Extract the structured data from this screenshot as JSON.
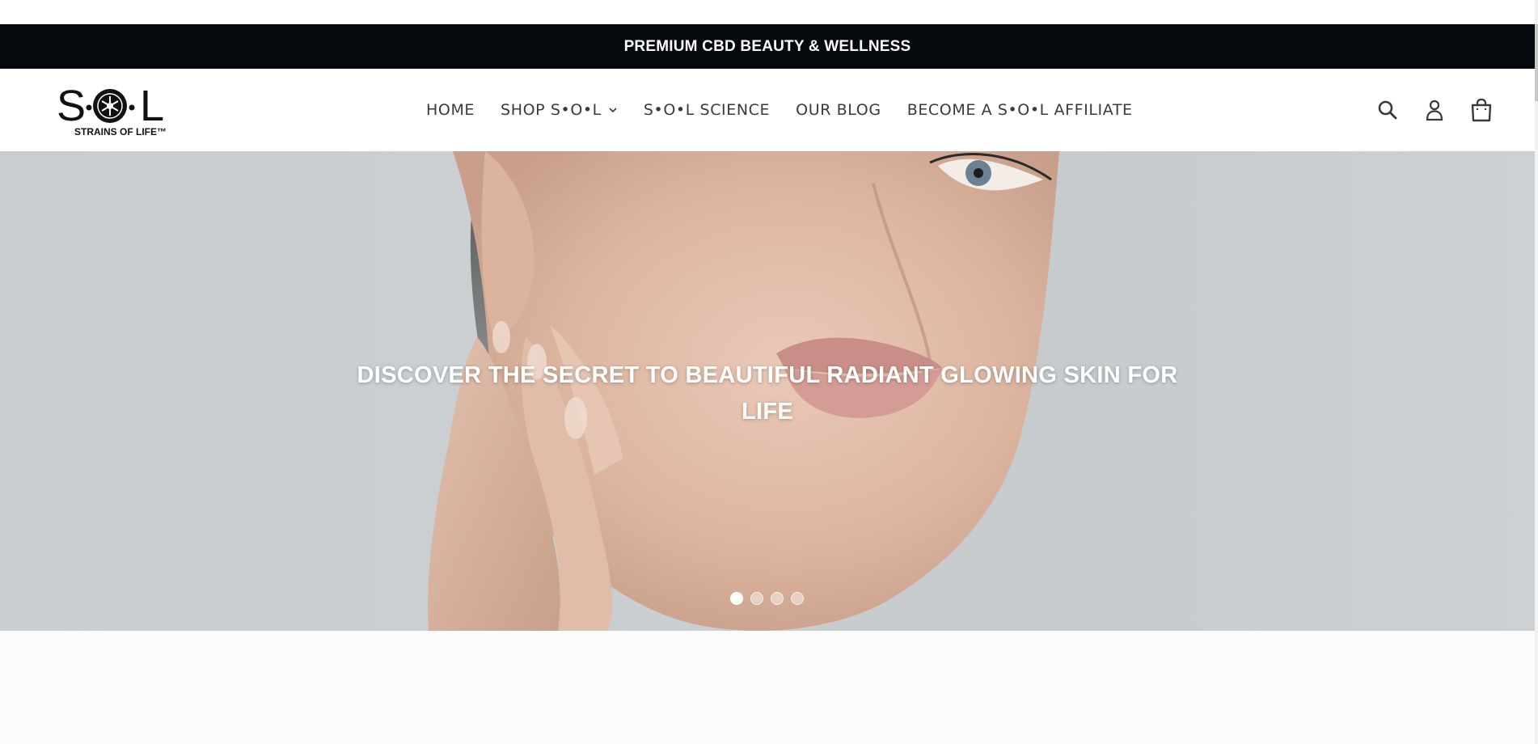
{
  "announcement": {
    "text": "PREMIUM CBD BEAUTY & WELLNESS"
  },
  "logo": {
    "wordmark": "S•O•L",
    "tagline": "STRAINS OF LIFE™"
  },
  "nav": {
    "items": [
      {
        "label": "HOME"
      },
      {
        "label": "SHOP S•O•L",
        "has_dropdown": true
      },
      {
        "label": "S•O•L SCIENCE"
      },
      {
        "label": "OUR BLOG"
      },
      {
        "label": "BECOME A S•O•L AFFILIATE"
      }
    ]
  },
  "header_icons": [
    "search-icon",
    "account-icon",
    "cart-icon"
  ],
  "hero": {
    "title": "DISCOVER THE SECRET TO BEAUTIFUL RADIANT GLOWING SKIN FOR LIFE",
    "slides_total": 4,
    "active_slide": 1
  },
  "colors": {
    "announcement_bg": "#05080c",
    "announcement_text": "#ffffff",
    "nav_text": "#3a3a3a",
    "hero_bg": "#c9cdcf"
  }
}
